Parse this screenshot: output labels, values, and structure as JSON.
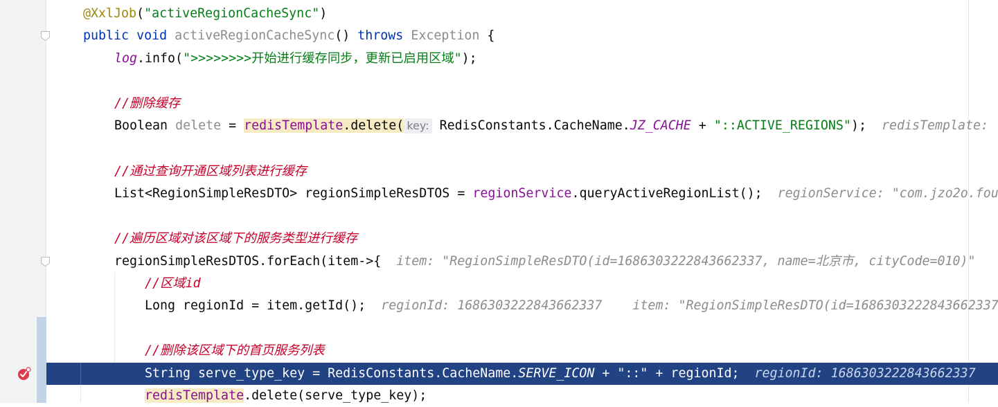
{
  "lines": {
    "l1": {
      "annotation": "@XxlJob",
      "open": "(",
      "arg": "\"activeRegionCacheSync\"",
      "close": ")"
    },
    "l2": {
      "kw1": "public",
      "kw2": "void",
      "name": "activeRegionCacheSync",
      "paren": "()",
      "kw3": "throws",
      "exc": "Exception",
      "brace": "{"
    },
    "l3": {
      "obj": "log",
      "call": ".info(",
      "str": "\">>>>>>>>开始进行缓存同步，更新已启用区域\"",
      "end": ");"
    },
    "l5": {
      "comment": "//删除缓存"
    },
    "l6": {
      "type": "Boolean",
      "var": "delete",
      "eq": "=",
      "field": "redisTemplate",
      "call": ".delete(",
      "hint": "key:",
      "cls": "RedisConstants.CacheName.",
      "const": "JZ_CACHE",
      "plus": "+",
      "str": "\"::ACTIVE_REGIONS\"",
      "end": ");",
      "inline": "redisTemplate:"
    },
    "l8": {
      "comment": "//通过查询开通区域列表进行缓存"
    },
    "l9": {
      "type": "List<RegionSimpleResDTO>",
      "var": "regionSimpleResDTOS",
      "eq": "=",
      "field": "regionService",
      "call": ".queryActiveRegionList();",
      "inline": "regionService: \"com.jzo2o.fou"
    },
    "l11": {
      "comment": "//遍历区域对该区域下的服务类型进行缓存"
    },
    "l12": {
      "code": "regionSimpleResDTOS.forEach(item->{",
      "inline": "item: \"RegionSimpleResDTO(id=1686303222843662337, name=北京市, cityCode=010)\""
    },
    "l13": {
      "comment": "//区域id"
    },
    "l14": {
      "code": "Long regionId = item.getId();",
      "inline1": "regionId: 1686303222843662337",
      "inline2": "item: \"RegionSimpleResDTO(id=1686303222843662337"
    },
    "l16": {
      "comment": "//删除该区域下的首页服务列表"
    },
    "l17": {
      "code1": "String serve_type_key = RedisConstants.CacheName.",
      "const": "SERVE_ICON",
      "code2": " + \"::\" + regionId;",
      "inline": "regionId: 1686303222843662337"
    },
    "l18": {
      "field": "redisTemplate",
      "call": ".delete(serve_type_key);"
    }
  }
}
